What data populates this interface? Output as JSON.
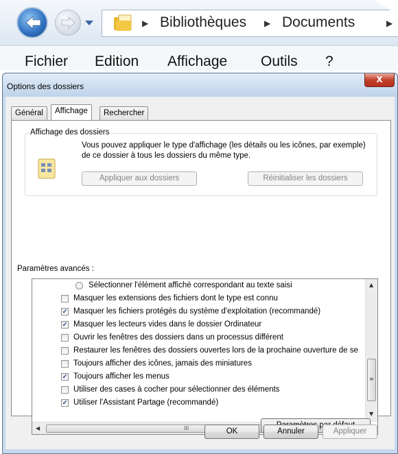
{
  "explorer": {
    "breadcrumb": [
      "Bibliothèques",
      "Documents"
    ],
    "separator": "▶",
    "menu": [
      "Fichier",
      "Edition",
      "Affichage",
      "Outils",
      "?"
    ]
  },
  "dialog": {
    "title": "Options des dossiers",
    "close_glyph": "X",
    "tabs": [
      {
        "label": "Général",
        "active": false
      },
      {
        "label": "Affichage",
        "active": true
      },
      {
        "label": "Rechercher",
        "active": false
      }
    ],
    "folder_view": {
      "group_label": "Affichage des dossiers",
      "description": "Vous pouvez appliquer le type d'affichage (les détails ou les icônes, par exemple) de ce dossier à tous les dossiers du même type.",
      "apply_button": "Appliquer aux dossiers",
      "reset_button": "Réinitialiser les dossiers"
    },
    "advanced_label": "Paramètres avancés :",
    "settings": [
      {
        "type": "radio",
        "checked": false,
        "label": "Sélectionner l'élément affiché correspondant au texte saisi"
      },
      {
        "type": "check",
        "checked": false,
        "label": "Masquer les extensions des fichiers dont le type est connu"
      },
      {
        "type": "check",
        "checked": true,
        "label": "Masquer les fichiers protégés du système d'exploitation (recommandé)"
      },
      {
        "type": "check",
        "checked": true,
        "label": "Masquer les lecteurs vides dans le dossier Ordinateur"
      },
      {
        "type": "check",
        "checked": false,
        "label": "Ouvrir les fenêtres des dossiers dans un processus différent"
      },
      {
        "type": "check",
        "checked": false,
        "label": "Restaurer les fenêtres des dossiers ouvertes lors de la prochaine ouverture de se"
      },
      {
        "type": "check",
        "checked": false,
        "label": "Toujours afficher des icônes, jamais des miniatures"
      },
      {
        "type": "check",
        "checked": true,
        "label": "Toujours afficher les menus"
      },
      {
        "type": "check",
        "checked": false,
        "label": "Utiliser des cases à cocher pour sélectionner des éléments"
      },
      {
        "type": "check",
        "checked": true,
        "label": "Utiliser l'Assistant Partage (recommandé)"
      }
    ],
    "check_glyph": "✓",
    "scroll_glyphs": {
      "up": "▲",
      "down": "▼",
      "left": "◀",
      "right": "▶",
      "grip_v": "≡",
      "grip_h": "III"
    },
    "defaults_button": "Paramètres par défaut",
    "footer_buttons": {
      "ok": "OK",
      "cancel": "Annuler",
      "apply": "Appliquer"
    }
  }
}
